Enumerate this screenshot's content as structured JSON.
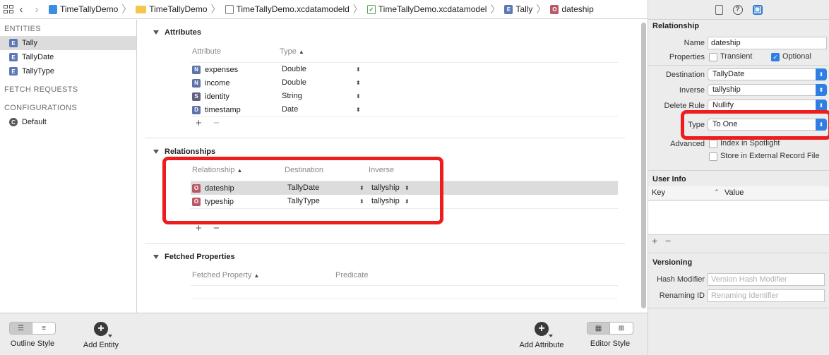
{
  "breadcrumb": {
    "items": [
      {
        "label": "TimeTallyDemo",
        "icon": "xcode-project-icon"
      },
      {
        "label": "TimeTallyDemo",
        "icon": "folder-icon"
      },
      {
        "label": "TimeTallyDemo.xcdatamodeld",
        "icon": "datamodel-bundle-icon"
      },
      {
        "label": "TimeTallyDemo.xcdatamodel",
        "icon": "datamodel-file-icon"
      },
      {
        "label": "Tally",
        "icon": "entity-icon"
      },
      {
        "label": "dateship",
        "icon": "relationship-icon"
      }
    ]
  },
  "sidebar": {
    "entities_title": "ENTITIES",
    "entities": [
      {
        "label": "Tally",
        "badge": "E",
        "selected": true
      },
      {
        "label": "TallyDate",
        "badge": "E",
        "selected": false
      },
      {
        "label": "TallyType",
        "badge": "E",
        "selected": false
      }
    ],
    "fetch_requests_title": "FETCH REQUESTS",
    "configurations_title": "CONFIGURATIONS",
    "configurations": [
      {
        "label": "Default",
        "badge": "C"
      }
    ]
  },
  "attributes": {
    "title": "Attributes",
    "col_attribute": "Attribute",
    "col_type": "Type",
    "rows": [
      {
        "badge": "N",
        "name": "expenses",
        "type": "Double"
      },
      {
        "badge": "N",
        "name": "income",
        "type": "Double"
      },
      {
        "badge": "S",
        "name": "identity",
        "type": "String"
      },
      {
        "badge": "D",
        "name": "timestamp",
        "type": "Date"
      }
    ]
  },
  "relationships": {
    "title": "Relationships",
    "col_relationship": "Relationship",
    "col_destination": "Destination",
    "col_inverse": "Inverse",
    "rows": [
      {
        "badge": "O",
        "name": "dateship",
        "destination": "TallyDate",
        "inverse": "tallyship",
        "selected": true
      },
      {
        "badge": "O",
        "name": "typeship",
        "destination": "TallyType",
        "inverse": "tallyship",
        "selected": false
      }
    ]
  },
  "fetched_properties": {
    "title": "Fetched Properties",
    "col_property": "Fetched Property",
    "col_predicate": "Predicate"
  },
  "bottom_bar": {
    "outline_style": "Outline Style",
    "add_entity": "Add Entity",
    "add_attribute": "Add Attribute",
    "editor_style": "Editor Style"
  },
  "inspector": {
    "section_relationship": "Relationship",
    "name_label": "Name",
    "name_value": "dateship",
    "properties_label": "Properties",
    "transient_label": "Transient",
    "transient_checked": false,
    "optional_label": "Optional",
    "optional_checked": true,
    "destination_label": "Destination",
    "destination_value": "TallyDate",
    "inverse_label": "Inverse",
    "inverse_value": "tallyship",
    "delete_rule_label": "Delete Rule",
    "delete_rule_value": "Nullify",
    "type_label": "Type",
    "type_value": "To One",
    "advanced_label": "Advanced",
    "spotlight_label": "Index in Spotlight",
    "external_label": "Store in External Record File",
    "section_user_info": "User Info",
    "key_col": "Key",
    "value_col": "Value",
    "section_versioning": "Versioning",
    "hash_label": "Hash Modifier",
    "hash_placeholder": "Version Hash Modifier",
    "renaming_label": "Renaming ID",
    "renaming_placeholder": "Renaming Identifier"
  },
  "colors": {
    "highlight_red": "#ee1c1c",
    "accent_blue": "#2f7ee3",
    "selection_gray": "#dcdcdc"
  }
}
